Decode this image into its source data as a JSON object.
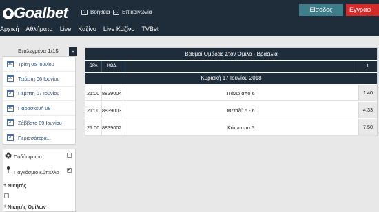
{
  "header": {
    "logo": "Goalbet",
    "help": "Βοήθεια",
    "contact": "Επικοινωνία",
    "login": "Είσοδος",
    "register": "Εγγραφ"
  },
  "nav": [
    "Αρχική",
    "Αθλήματα",
    "Live",
    "Καζίνο",
    "Live Καζίνο",
    "TVBet"
  ],
  "sidebar": {
    "selected": "Επιλεγμένα 1/15",
    "close": "×",
    "dates": [
      {
        "cal": "20",
        "label": "Τρίτη 05 Ιουνίου"
      },
      {
        "cal": "20",
        "label": "Τετάρτη 06 Ιουνίου"
      },
      {
        "cal": "20",
        "label": "Πέμπτη 07 Ιουνίου"
      },
      {
        "cal": "20",
        "label": "Παρασκευή 08"
      },
      {
        "cal": "20",
        "label": "Σάββατο 09 Ιουνίου"
      },
      {
        "cal": "20",
        "label": "Περισσότερα..."
      }
    ],
    "sport": "Ποδόσφαιρο",
    "competition": "Παγκόσμιο Κύπελλο",
    "market1": "Νικητής",
    "market2": "Νικητής Ομίλων"
  },
  "panel": {
    "title": "Βαθμοί Ομάδας Στον Όμιλο - Βραζιλία",
    "col_time": "ΩΡΑ",
    "col_code": "ΚΩΔ.",
    "col_1": "1",
    "day": "Κυριακή 17 Ιουνίου 2018",
    "rows": [
      {
        "time": "21:00",
        "code": "8839004",
        "desc": "Πάνω απο 6",
        "odd": "1.40"
      },
      {
        "time": "21:00",
        "code": "8839003",
        "desc": "Μεταξύ 5 - 6",
        "odd": "4.33"
      },
      {
        "time": "21:00",
        "code": "8839002",
        "desc": "Κάτω απο 5",
        "odd": "7.50"
      }
    ]
  },
  "colors": {
    "dark": "#1f2d3a",
    "accent": "#3e7d8a",
    "register": "#d32a2a"
  }
}
